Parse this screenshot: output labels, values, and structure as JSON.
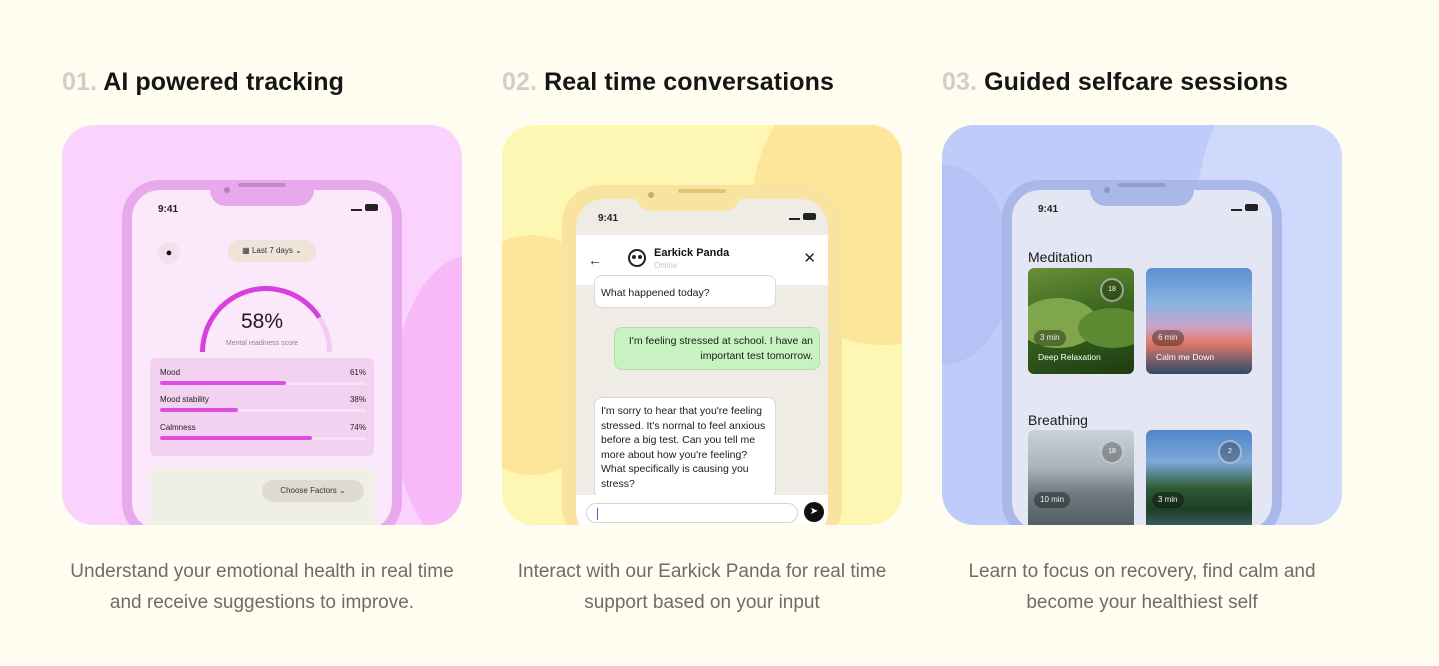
{
  "features": [
    {
      "number": "01.",
      "title": "AI powered tracking",
      "description": "Understand your emotional health in real time and receive suggestions to improve.",
      "phone": {
        "time": "9:41",
        "range_label": "Last 7 days",
        "gauge_value": "58%",
        "gauge_label": "Mental readiness score",
        "metrics": [
          {
            "label": "Mood",
            "value": "61%",
            "fraction": 0.61
          },
          {
            "label": "Mood stability",
            "value": "38%",
            "fraction": 0.38
          },
          {
            "label": "Calmness",
            "value": "74%",
            "fraction": 0.74
          }
        ],
        "factors_button": "Choose Factors"
      }
    },
    {
      "number": "02.",
      "title": "Real time conversations",
      "description": "Interact with our Earkick Panda for real time support based on your input",
      "phone": {
        "time": "9:41",
        "bot_name": "Earkick Panda",
        "bot_status": "Online",
        "messages": [
          {
            "from": "bot",
            "text": "What happened today?"
          },
          {
            "from": "user",
            "text": "I'm feeling stressed at school. I have an important test tomorrow."
          },
          {
            "from": "bot",
            "text": "I'm sorry to hear that you're feeling stressed. It's normal to feel anxious before a big test. Can you tell me more about how you're feeling? What specifically is causing you stress?"
          }
        ]
      }
    },
    {
      "number": "03.",
      "title": "Guided selfcare sessions",
      "description": "Learn to focus on recovery, find calm and become your healthiest self",
      "phone": {
        "time": "9:41",
        "sections": [
          {
            "title": "Meditation",
            "tiles": [
              {
                "duration": "3 min",
                "name": "Deep Relaxation",
                "badge": "18"
              },
              {
                "duration": "6 min",
                "name": "Calm me Down",
                "badge": ""
              }
            ]
          },
          {
            "title": "Breathing",
            "tiles": [
              {
                "duration": "10 min",
                "name": "",
                "badge": "18"
              },
              {
                "duration": "3 min",
                "name": "",
                "badge": "2"
              }
            ]
          }
        ]
      }
    }
  ],
  "colors": {
    "background": "#fefdf0",
    "card1": "#fbd2fd",
    "card2": "#fef6b3",
    "card3": "#bfccfa",
    "accent_pink": "#dc4fe0",
    "bubble_user": "#c9f2c2"
  },
  "icons": {
    "pin": "location-pin-icon",
    "calendar": "calendar-icon",
    "back": "arrow-left-icon",
    "close": "close-icon",
    "send": "send-icon",
    "avatar": "panda-icon"
  }
}
